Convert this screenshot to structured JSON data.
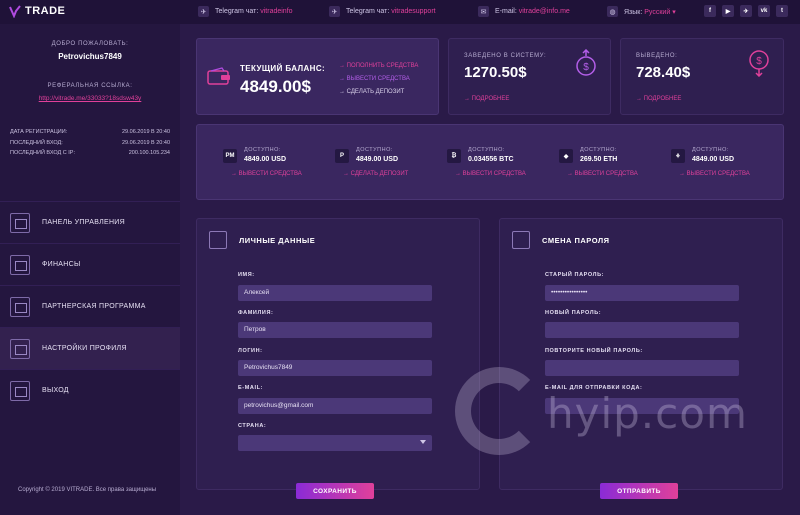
{
  "brand": {
    "name": "TRADE",
    "accent": "#e0409a",
    "purple": "#8a2bd6"
  },
  "topbar": {
    "telegram1_label": "Telegram чат:",
    "telegram1_link": "vitradeinfo",
    "telegram2_label": "Telegram чат:",
    "telegram2_link": "vitradesupport",
    "email_label": "E-mail:",
    "email_link": "vitrade@info.me",
    "lang_label": "Язык:",
    "lang_value": "Русский",
    "social": [
      "f",
      "▶",
      "✈",
      "vk",
      "t"
    ]
  },
  "sidebar": {
    "welcome": "ДОБРО ПОЖАЛОВАТЬ:",
    "username": "Petrovichus7849",
    "ref_title": "РЕФЕРАЛЬНАЯ ССЫЛКА:",
    "ref_link": "http://vitrade.me/33033?18sdsw43y",
    "stats": [
      {
        "label": "ДАТА РЕГИСТРАЦИИ:",
        "value": "29.06.2019 В 20:40"
      },
      {
        "label": "ПОСЛЕДНИЙ ВХОД:",
        "value": "29.06.2019 В 20:40"
      },
      {
        "label": "ПОСЛЕДНИЙ ВХОД С IP:",
        "value": "200.100.105.234"
      }
    ],
    "menu": [
      {
        "label": "ПАНЕЛЬ УПРАВЛЕНИЯ"
      },
      {
        "label": "ФИНАНСЫ"
      },
      {
        "label": "ПАРТНЕРСКАЯ ПРОГРАММА"
      },
      {
        "label": "НАСТРОЙКИ ПРОФИЛЯ"
      },
      {
        "label": "ВЫХОД"
      }
    ],
    "copyright": "Copyright © 2019 VITRADE. Все права защищены"
  },
  "balance": {
    "label": "ТЕКУЩИЙ БАЛАНС:",
    "value": "4849.00$",
    "link_topup": "→ ПОПОЛНИТЬ СРЕДСТВА",
    "link_withdraw": "→ ВЫВЕСТИ СРЕДСТВА",
    "link_deposit": "→ СДЕЛАТЬ ДЕПОЗИТ"
  },
  "deposited": {
    "label": "ЗАВЕДЕНО В СИСТЕМУ:",
    "value": "1270.50$",
    "more": "→ ПОДРОБНЕЕ"
  },
  "withdrawn": {
    "label": "ВЫВЕДЕНО:",
    "value": "728.40$",
    "more": "→ ПОДРОБНЕЕ"
  },
  "currencies": [
    {
      "badge": "PM",
      "label": "ДОСТУПНО:",
      "value": "4849.00 USD",
      "link": "→ ВЫВЕСТИ СРЕДСТВА"
    },
    {
      "badge": "P",
      "label": "ДОСТУПНО:",
      "value": "4849.00 USD",
      "link": "→ СДЕЛАТЬ ДЕПОЗИТ"
    },
    {
      "badge": "₿",
      "label": "ДОСТУПНО:",
      "value": "0.034556 BTC",
      "link": "→ ВЫВЕСТИ СРЕДСТВА"
    },
    {
      "badge": "◆",
      "label": "ДОСТУПНО:",
      "value": "269.50 ETH",
      "link": "→ ВЫВЕСТИ СРЕДСТВА"
    },
    {
      "badge": "⚘",
      "label": "ДОСТУПНО:",
      "value": "4849.00 USD",
      "link": "→ ВЫВЕСТИ СРЕДСТВА"
    }
  ],
  "personal": {
    "title": "ЛИЧНЫЕ ДАННЫЕ",
    "name_label": "ИМЯ:",
    "name_value": "Алексей",
    "surname_label": "ФАМИЛИЯ:",
    "surname_value": "Петров",
    "login_label": "ЛОГИН:",
    "login_value": "Petrovichus7849",
    "email_label": "E-MAIL:",
    "email_value": "petrovichus@gmail.com",
    "country_label": "СТРАНА:",
    "country_value": "",
    "save_button": "СОХРАНИТЬ"
  },
  "password": {
    "title": "СМЕНА ПАРОЛЯ",
    "old_label": "СТАРЫЙ ПАРОЛЬ:",
    "old_value": "••••••••••••••••",
    "new_label": "НОВЫЙ ПАРОЛЬ:",
    "new_value": "",
    "repeat_label": "ПОВТОРИТЕ НОВЫЙ ПАРОЛЬ:",
    "repeat_value": "",
    "code_email_label": "E-MAIL ДЛЯ ОТПРАВКИ КОДА:",
    "code_email_value": "",
    "send_button": "ОТПРАВИТЬ"
  },
  "watermark": "hyip.com"
}
